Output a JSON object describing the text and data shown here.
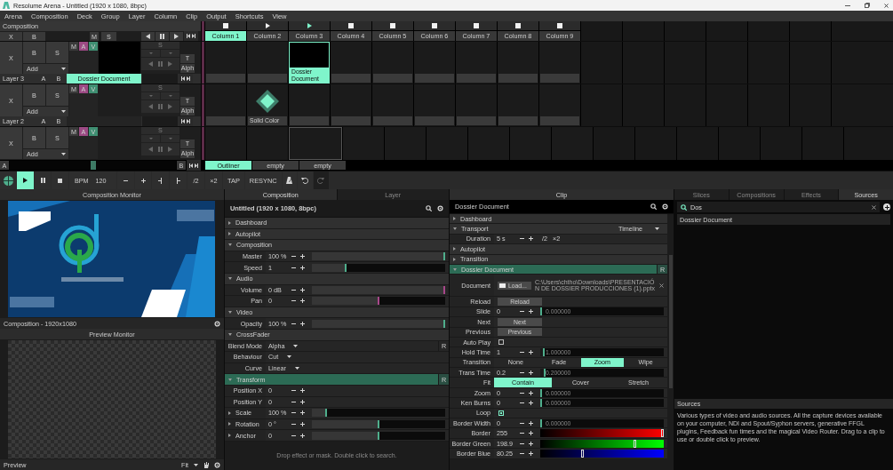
{
  "window": {
    "title": "Resolume Arena - Untitled (1920 x 1080, 8bpc)"
  },
  "menu": [
    "Arena",
    "Composition",
    "Deck",
    "Group",
    "Layer",
    "Column",
    "Clip",
    "Output",
    "Shortcuts",
    "View"
  ],
  "composition_bar": {
    "label": "Composition",
    "controls": [
      "X",
      "B",
      "M",
      "S"
    ]
  },
  "columns": [
    {
      "label": "Column 1",
      "selected": true,
      "kind": "stop",
      "playing": false
    },
    {
      "label": "Column 2",
      "selected": false,
      "kind": "play",
      "playing": false
    },
    {
      "label": "Column 3",
      "selected": false,
      "kind": "play",
      "playing": true
    },
    {
      "label": "Column 4",
      "selected": false,
      "kind": "stop",
      "playing": false
    },
    {
      "label": "Column 5",
      "selected": false,
      "kind": "stop",
      "playing": false
    },
    {
      "label": "Column 6",
      "selected": false,
      "kind": "stop",
      "playing": false
    },
    {
      "label": "Column 7",
      "selected": false,
      "kind": "stop",
      "playing": false
    },
    {
      "label": "Column 8",
      "selected": false,
      "kind": "stop",
      "playing": false
    },
    {
      "label": "Column 9",
      "selected": false,
      "kind": "stop",
      "playing": false
    }
  ],
  "layers": [
    {
      "name": "Layer 3",
      "controls": [
        "X",
        "B",
        "S"
      ],
      "blend": "Add",
      "mav": [
        {
          "label": "M",
          "on": false
        },
        {
          "label": "A",
          "on": true,
          "color": "#9c4a84"
        },
        {
          "label": "V",
          "on": true,
          "color": "#3f8f72"
        }
      ],
      "solo": "S",
      "side": [
        "T",
        "Alph"
      ],
      "ab": [
        "A",
        "B"
      ],
      "clip_name": "Dossier Document",
      "clips": [
        {
          "kind": "empty",
          "connected": false,
          "selected": false
        },
        {
          "kind": "empty",
          "connected": false,
          "selected": false
        },
        {
          "kind": "document",
          "label": "Dossier Document",
          "connected": true,
          "selected": false
        },
        {
          "kind": "empty",
          "connected": false,
          "selected": false
        },
        {
          "kind": "empty",
          "connected": false,
          "selected": false
        },
        {
          "kind": "empty",
          "connected": false,
          "selected": false
        },
        {
          "kind": "empty",
          "connected": false,
          "selected": false
        },
        {
          "kind": "empty",
          "connected": false,
          "selected": false
        },
        {
          "kind": "empty",
          "connected": false,
          "selected": false
        }
      ]
    },
    {
      "name": "Layer 2",
      "controls": [
        "X",
        "B",
        "S"
      ],
      "blend": "Add",
      "mav": [
        {
          "label": "M",
          "on": false
        },
        {
          "label": "A",
          "on": true,
          "color": "#9c4a84"
        },
        {
          "label": "V",
          "on": true,
          "color": "#3f8f72"
        }
      ],
      "solo": "S",
      "side": [
        "T",
        "Alph"
      ],
      "ab": [
        "A",
        "B"
      ],
      "clips": [
        {
          "kind": "empty",
          "connected": false,
          "selected": false
        },
        {
          "kind": "solid",
          "label": "Solid Color",
          "connected": false,
          "selected": false
        },
        {
          "kind": "empty",
          "connected": false,
          "selected": false
        },
        {
          "kind": "empty",
          "connected": false,
          "selected": false
        },
        {
          "kind": "empty",
          "connected": false,
          "selected": false
        },
        {
          "kind": "empty",
          "connected": false,
          "selected": false
        },
        {
          "kind": "empty",
          "connected": false,
          "selected": false
        },
        {
          "kind": "empty",
          "connected": false,
          "selected": false
        },
        {
          "kind": "empty",
          "connected": false,
          "selected": false
        }
      ]
    },
    {
      "controls": [
        "X",
        "B",
        "S"
      ],
      "blend": "Add",
      "mav": [
        {
          "label": "M",
          "on": false
        },
        {
          "label": "A",
          "on": true,
          "color": "#9c4a84"
        },
        {
          "label": "V",
          "on": true,
          "color": "#3f8f72"
        }
      ],
      "solo": "S",
      "side": [
        "T",
        "Alph"
      ],
      "clips": [
        {
          "kind": "empty",
          "connected": false,
          "selected": false
        },
        {
          "kind": "empty",
          "connected": false,
          "selected": false
        },
        {
          "kind": "empty",
          "connected": false,
          "selected": true
        },
        {
          "kind": "empty",
          "connected": false,
          "selected": false
        },
        {
          "kind": "empty",
          "connected": false,
          "selected": false
        },
        {
          "kind": "empty",
          "connected": false,
          "selected": false
        },
        {
          "kind": "empty",
          "connected": false,
          "selected": false
        },
        {
          "kind": "empty",
          "connected": false,
          "selected": false
        },
        {
          "kind": "empty",
          "connected": false,
          "selected": false
        }
      ]
    }
  ],
  "deck_bar": {
    "a": "A",
    "b": "B",
    "level": 0.5,
    "decks": [
      {
        "label": "Outliner",
        "selected": true
      },
      {
        "label": "empty",
        "selected": false
      },
      {
        "label": "empty",
        "selected": false
      }
    ]
  },
  "transport": [
    {
      "kind": "clock"
    },
    {
      "kind": "play",
      "selected": true
    },
    {
      "kind": "pause",
      "selected": false
    },
    {
      "kind": "stop",
      "selected": false
    },
    {
      "kind": "bpm",
      "label": "BPM",
      "value": "120"
    },
    {
      "kind": "minus"
    },
    {
      "kind": "plus"
    },
    {
      "kind": "nudge-left"
    },
    {
      "kind": "nudge-right"
    },
    {
      "kind": "text",
      "label": "/2"
    },
    {
      "kind": "text",
      "label": "×2"
    },
    {
      "kind": "text",
      "label": "TAP"
    },
    {
      "kind": "text",
      "label": "RESYNC"
    },
    {
      "kind": "metronome",
      "disabled": false
    },
    {
      "kind": "undo",
      "disabled": false
    },
    {
      "kind": "redo",
      "disabled": true
    }
  ],
  "composition_monitor": {
    "title": "Composition Monitor",
    "footer": "Composition - 1920x1080"
  },
  "preview_monitor": {
    "title": "Preview Monitor",
    "footer": "Preview",
    "fit": "Fit"
  },
  "composition_panel": {
    "tabs": [
      {
        "label": "Composition",
        "selected": true
      },
      {
        "label": "Layer",
        "selected": false
      }
    ],
    "title": "Untitled (1920 x 1080, 8bpc)",
    "rows": [
      {
        "kind": "section",
        "label": "Dashboard",
        "expanded": false,
        "highlighted": false
      },
      {
        "kind": "section",
        "label": "Autopilot",
        "expanded": false,
        "highlighted": false
      },
      {
        "kind": "section",
        "label": "Composition",
        "expanded": true,
        "highlighted": false
      },
      {
        "kind": "slider",
        "label": "Master",
        "value": "100 %",
        "level": 1,
        "color": "#4fae8c"
      },
      {
        "kind": "slider",
        "label": "Speed",
        "value": "1",
        "level": 0.25,
        "color": "#4fae8c"
      },
      {
        "kind": "section",
        "label": "Audio",
        "expanded": true,
        "highlighted": false
      },
      {
        "kind": "slider",
        "label": "Volume",
        "value": "0 dB",
        "level": 1,
        "color": "#a8478a"
      },
      {
        "kind": "slider",
        "label": "Pan",
        "value": "0",
        "level": 0.5,
        "color": "#a8478a"
      },
      {
        "kind": "section",
        "label": "Video",
        "expanded": true,
        "highlighted": false
      },
      {
        "kind": "slider",
        "label": "Opacity",
        "value": "100 %",
        "level": 1,
        "color": "#4fae8c"
      },
      {
        "kind": "section",
        "label": "CrossFader",
        "expanded": true,
        "highlighted": false
      },
      {
        "kind": "select",
        "label": "Blend Mode",
        "value": "Alpha",
        "reset": "R"
      },
      {
        "kind": "select",
        "label": "Behaviour",
        "value": "Cut"
      },
      {
        "kind": "select",
        "label": "Curve",
        "value": "Linear"
      },
      {
        "kind": "section",
        "label": "Transform",
        "expanded": true,
        "highlighted": true,
        "reset": "R"
      },
      {
        "kind": "number",
        "label": "Position X",
        "value": "0"
      },
      {
        "kind": "number",
        "label": "Position Y",
        "value": "0"
      },
      {
        "kind": "slider",
        "label": "Scale",
        "value": "100 %",
        "level": 0.1,
        "color": "#4fae8c",
        "expanded": false
      },
      {
        "kind": "slider",
        "label": "Rotation",
        "value": "0 °",
        "level": 0.5,
        "color": "#4fae8c",
        "expanded": false
      },
      {
        "kind": "slider",
        "label": "Anchor",
        "value": "0",
        "level": 0.5,
        "color": "#4fae8c",
        "expanded": false
      }
    ],
    "drop_hint": "Drop effect or mask. Double click to search."
  },
  "clip_panel": {
    "tab": "Clip",
    "title": "Dossier Document",
    "rows": [
      {
        "kind": "section",
        "label": "Dashboard",
        "expanded": false,
        "highlighted": false
      },
      {
        "kind": "section",
        "label": "Transport",
        "expanded": true,
        "highlighted": false,
        "mode": "Timeline"
      },
      {
        "kind": "duration",
        "label": "Duration",
        "value": "5 s",
        "extras": [
          "/2",
          "×2"
        ]
      },
      {
        "kind": "section",
        "label": "Autopilot",
        "expanded": false,
        "highlighted": false
      },
      {
        "kind": "section",
        "label": "Transition",
        "expanded": false,
        "highlighted": false
      },
      {
        "kind": "section",
        "label": "Dossier Document",
        "expanded": true,
        "highlighted": true,
        "reset": "R"
      },
      {
        "kind": "file",
        "label": "Document",
        "button": "Load...",
        "path": "C:\\Users\\chtho\\Downloads\\PRESENTACIÓN DE DOSSIER PRODUCCIONES (1).pptx"
      },
      {
        "kind": "button",
        "label": "Reload",
        "button": "Reload"
      },
      {
        "kind": "slider",
        "label": "Slide",
        "value": "0",
        "reading": "0.000000",
        "level": 0
      },
      {
        "kind": "button",
        "label": "Next",
        "button": "Next"
      },
      {
        "kind": "button",
        "label": "Previous",
        "button": "Previous"
      },
      {
        "kind": "checkbox",
        "label": "Auto Play",
        "checked": false
      },
      {
        "kind": "slider",
        "label": "Hold Time",
        "value": "1",
        "reading": "1.000000",
        "level": 0.02
      },
      {
        "kind": "choice",
        "label": "Transition",
        "options": [
          {
            "label": "None",
            "selected": false
          },
          {
            "label": "Fade",
            "selected": false
          },
          {
            "label": "Zoom",
            "selected": true
          },
          {
            "label": "Wipe",
            "selected": false
          }
        ]
      },
      {
        "kind": "slider",
        "label": "Trans Time",
        "value": "0.2",
        "reading": "0.200000",
        "level": 0.03
      },
      {
        "kind": "choice",
        "label": "Fit",
        "options": [
          {
            "label": "Contain",
            "selected": true
          },
          {
            "label": "Cover",
            "selected": false
          },
          {
            "label": "Stretch",
            "selected": false
          }
        ]
      },
      {
        "kind": "slider",
        "label": "Zoom",
        "value": "0",
        "reading": "0.000000",
        "level": 0
      },
      {
        "kind": "slider",
        "label": "Ken Burns",
        "value": "0",
        "reading": "0.000000",
        "level": 0
      },
      {
        "kind": "checkbox",
        "label": "Loop",
        "checked": true
      },
      {
        "kind": "slider",
        "label": "Border Width",
        "value": "0",
        "reading": "0.000000",
        "level": 0
      },
      {
        "kind": "red",
        "label": "Border",
        "value": "255",
        "level": 1
      },
      {
        "kind": "green",
        "label": "Border Green",
        "value": "198.9",
        "level": 0.78
      },
      {
        "kind": "blue",
        "label": "Border Blue",
        "value": "80.25",
        "level": 0.35
      }
    ]
  },
  "browser": {
    "tabs": [
      {
        "label": "Slices",
        "selected": false
      },
      {
        "label": "Compositions",
        "selected": false
      },
      {
        "label": "Effects",
        "selected": false
      },
      {
        "label": "Sources",
        "selected": true
      }
    ],
    "search": {
      "value": "Dos"
    },
    "results": [
      "Dossier Document"
    ],
    "info": {
      "title": "Sources",
      "text": "Various types of video and audio sources. All the capture devices available on your computer, NDI and Spout/Syphon servers, generative FFGL plugins, Feedback fun times and the magical Video Router. Drag to a clip to use or double click to preview."
    }
  }
}
